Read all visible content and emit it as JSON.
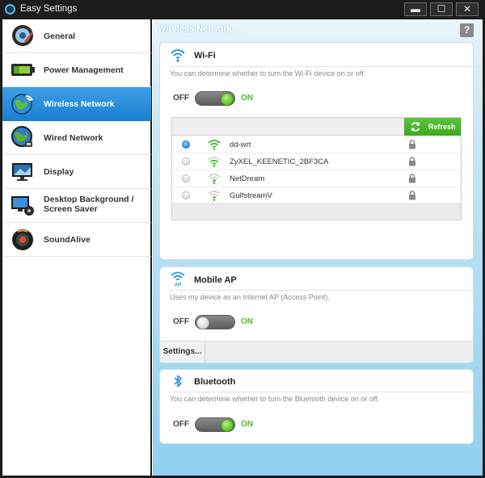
{
  "window": {
    "title": "Easy Settings",
    "minimize": "▬",
    "maximize": "☐",
    "close": "✕"
  },
  "sidebar": {
    "items": [
      {
        "label": "General",
        "icon": "general-icon"
      },
      {
        "label": "Power Management",
        "icon": "battery-icon"
      },
      {
        "label": "Wireless Network",
        "icon": "wireless-globe-icon",
        "active": true
      },
      {
        "label": "Wired Network",
        "icon": "wired-globe-icon"
      },
      {
        "label": "Display",
        "icon": "display-icon"
      },
      {
        "label": "Desktop Background /",
        "label2": "Screen Saver",
        "icon": "desktop-background-icon"
      },
      {
        "label": "SoundAlive",
        "icon": "speaker-icon"
      }
    ]
  },
  "main": {
    "title": "Wireless Network",
    "help": "?"
  },
  "wifi": {
    "title": "Wi-Fi",
    "description": "You can determine whether to turn the Wi-Fi device on or off.",
    "off_label": "OFF",
    "on_label": "ON",
    "state": "on",
    "refresh_label": "Refresh",
    "networks": [
      {
        "ssid": "dd-wrt",
        "selected": true,
        "signal": "strong",
        "locked": true
      },
      {
        "ssid": "ZyXEL_KEENETIC_2BF3CA",
        "selected": false,
        "signal": "medium",
        "locked": true
      },
      {
        "ssid": "NetDream",
        "selected": false,
        "signal": "weak",
        "locked": true
      },
      {
        "ssid": "GulfstreamV",
        "selected": false,
        "signal": "weak",
        "locked": true
      }
    ]
  },
  "mobile_ap": {
    "title": "Mobile AP",
    "icon_badge": "AP",
    "description": "Uses my device as an Internet AP (Access Point).",
    "off_label": "OFF",
    "on_label": "ON",
    "state": "off",
    "settings_label": "Settings..."
  },
  "bluetooth": {
    "title": "Bluetooth",
    "description": "You can determine whether to turn the Bluetooth device on or off.",
    "off_label": "OFF",
    "on_label": "ON",
    "state": "on"
  },
  "colors": {
    "accent": "#2f93df",
    "on_green": "#54b72a",
    "titlebar": "#1c1c1c"
  }
}
